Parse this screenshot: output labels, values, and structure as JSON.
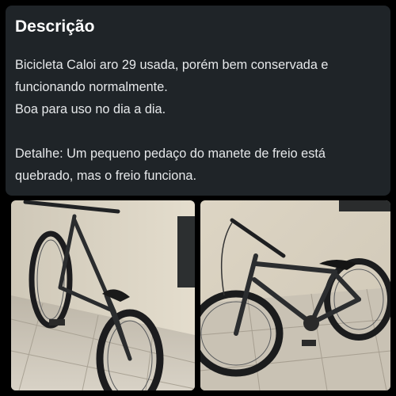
{
  "listing": {
    "description_title": "Descrição",
    "description_lines": [
      "Bicicleta Caloi aro 29 usada, porém bem conservada e",
      "funcionando normalmente.",
      "Boa para uso no dia a dia."
    ],
    "detail_lines": [
      "Detalhe: Um pequeno pedaço do manete de freio está",
      "quebrado, mas o freio funciona."
    ]
  },
  "colors": {
    "card_background": "#1f2428",
    "page_background": "#000000",
    "text_primary": "#ffffff",
    "text_body": "#e6e8ea"
  },
  "photos": [
    {
      "icon": "bicycle-photo",
      "subject": "bicycle-front-view"
    },
    {
      "icon": "bicycle-photo",
      "subject": "bicycle-side-view"
    }
  ]
}
